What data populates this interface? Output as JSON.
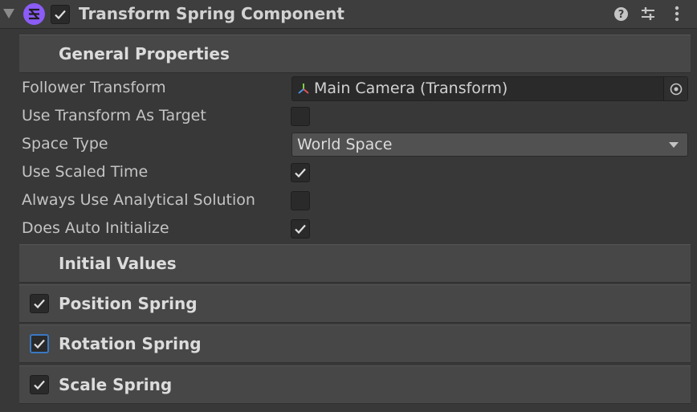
{
  "header": {
    "title": "Transform Spring Component",
    "enabled": true,
    "icons": [
      "component-icon",
      "help-icon",
      "presets-icon",
      "kebab-menu-icon"
    ]
  },
  "sections": {
    "general": "General Properties",
    "initial": "Initial Values"
  },
  "properties": {
    "follower_transform": {
      "label": "Follower Transform",
      "value": "Main Camera (Transform)"
    },
    "use_transform_as_target": {
      "label": "Use Transform As Target",
      "checked": false
    },
    "space_type": {
      "label": "Space Type",
      "value": "World Space"
    },
    "use_scaled_time": {
      "label": "Use Scaled Time",
      "checked": true
    },
    "always_use_analytical": {
      "label": "Always Use Analytical Solution",
      "checked": false
    },
    "does_auto_initialize": {
      "label": "Does Auto Initialize",
      "checked": true
    }
  },
  "springs": {
    "position": {
      "label": "Position Spring",
      "checked": true
    },
    "rotation": {
      "label": "Rotation Spring",
      "checked": true
    },
    "scale": {
      "label": "Scale Spring",
      "checked": true
    }
  },
  "colors": {
    "background": "#383838",
    "section": "#474747",
    "accent": "#8b5cf6",
    "focus": "#3a78c2"
  }
}
